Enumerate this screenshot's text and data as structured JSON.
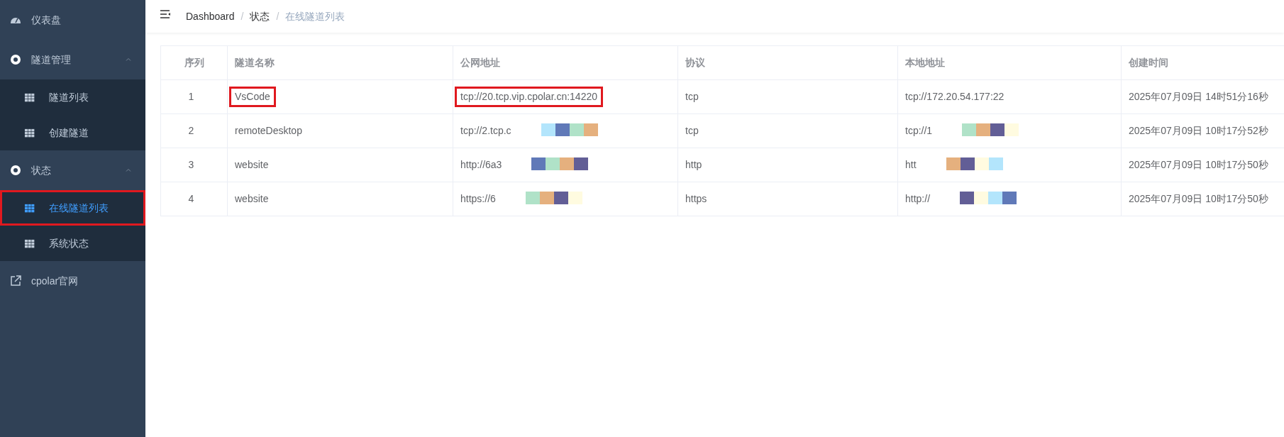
{
  "sidebar": {
    "items": [
      {
        "label": "仪表盘",
        "kind": "dashboard"
      },
      {
        "label": "隧道管理",
        "kind": "group",
        "expanded": true,
        "children": [
          {
            "label": "隧道列表",
            "selected": false,
            "highlighted": false
          },
          {
            "label": "创建隧道",
            "selected": false,
            "highlighted": false
          }
        ]
      },
      {
        "label": "状态",
        "kind": "group",
        "expanded": true,
        "children": [
          {
            "label": "在线隧道列表",
            "selected": true,
            "highlighted": true
          },
          {
            "label": "系统状态",
            "selected": false,
            "highlighted": false
          }
        ]
      },
      {
        "label": "cpolar官网",
        "kind": "external"
      }
    ]
  },
  "breadcrumb": [
    {
      "label": "Dashboard"
    },
    {
      "separator": "/",
      "label": "状态"
    },
    {
      "separator": "/",
      "label": "在线隧道列表"
    }
  ],
  "table": {
    "columns": [
      "序列",
      "隧道名称",
      "公网地址",
      "协议",
      "本地地址",
      "创建时间"
    ],
    "rows": [
      {
        "cells": [
          {
            "text": "1"
          },
          {
            "text": "VsCode",
            "highlighted": true
          },
          {
            "text": "tcp://20.tcp.vip.cpolar.cn:14220",
            "highlighted": true
          },
          {
            "text": "tcp"
          },
          {
            "text": "tcp://172.20.54.177:22"
          },
          {
            "text": "2025年07月09日 14时51分16秒"
          }
        ]
      },
      {
        "cells": [
          {
            "text": "2"
          },
          {
            "text": "remoteDesktop"
          },
          {
            "text": "tcp://2.tcp.c",
            "redacted": true
          },
          {
            "text": "tcp"
          },
          {
            "text": "tcp://1",
            "redacted": true
          },
          {
            "text": "2025年07月09日 10时17分52秒"
          }
        ]
      },
      {
        "cells": [
          {
            "text": "3"
          },
          {
            "text": "website"
          },
          {
            "text": "http://6a3",
            "redacted": true
          },
          {
            "text": "http"
          },
          {
            "text": "htt",
            "redacted": true
          },
          {
            "text": "2025年07月09日 10时17分50秒"
          }
        ]
      },
      {
        "cells": [
          {
            "text": "4"
          },
          {
            "text": "website"
          },
          {
            "text": "https://6",
            "redacted": true
          },
          {
            "text": "https"
          },
          {
            "text": "http://",
            "redacted": true
          },
          {
            "text": "2025年07月09日 10时17分50秒"
          }
        ]
      }
    ]
  }
}
